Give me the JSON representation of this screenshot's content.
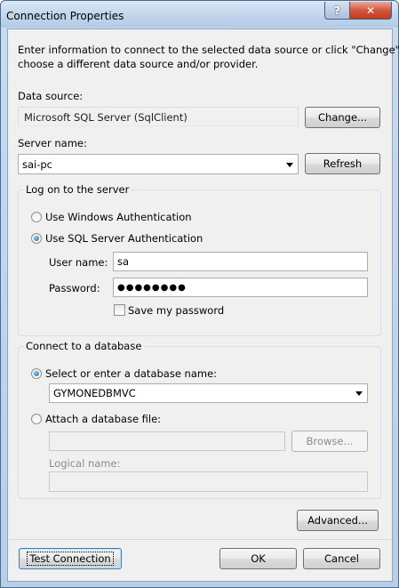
{
  "window": {
    "title": "Connection Properties",
    "help_glyph": "?",
    "close_glyph": "✕"
  },
  "intro": {
    "line1": "Enter information to connect to the selected data source or click \"Change\" to",
    "line2": "choose a different data source and/or provider."
  },
  "data_source": {
    "label": "Data source:",
    "value": "Microsoft SQL Server (SqlClient)",
    "change_label": "Change..."
  },
  "server": {
    "label": "Server name:",
    "value": "sai-pc",
    "refresh_label": "Refresh"
  },
  "logon": {
    "group_title": "Log on to the server",
    "windows_auth_label": "Use Windows Authentication",
    "sql_auth_label": "Use SQL Server Authentication",
    "selected": "sql",
    "username_label": "User name:",
    "username_value": "sa",
    "password_label": "Password:",
    "password_mask": "●●●●●●●●",
    "save_password_label": "Save my password"
  },
  "database": {
    "group_title": "Connect to a database",
    "select_label": "Select or enter a database name:",
    "selected_db": "GYMONEDBMVC",
    "attach_label": "Attach a database file:",
    "browse_label": "Browse...",
    "logical_name_label": "Logical name:"
  },
  "buttons": {
    "advanced_label": "Advanced...",
    "test_connection_label": "Test Connection",
    "ok_label": "OK",
    "cancel_label": "Cancel"
  }
}
